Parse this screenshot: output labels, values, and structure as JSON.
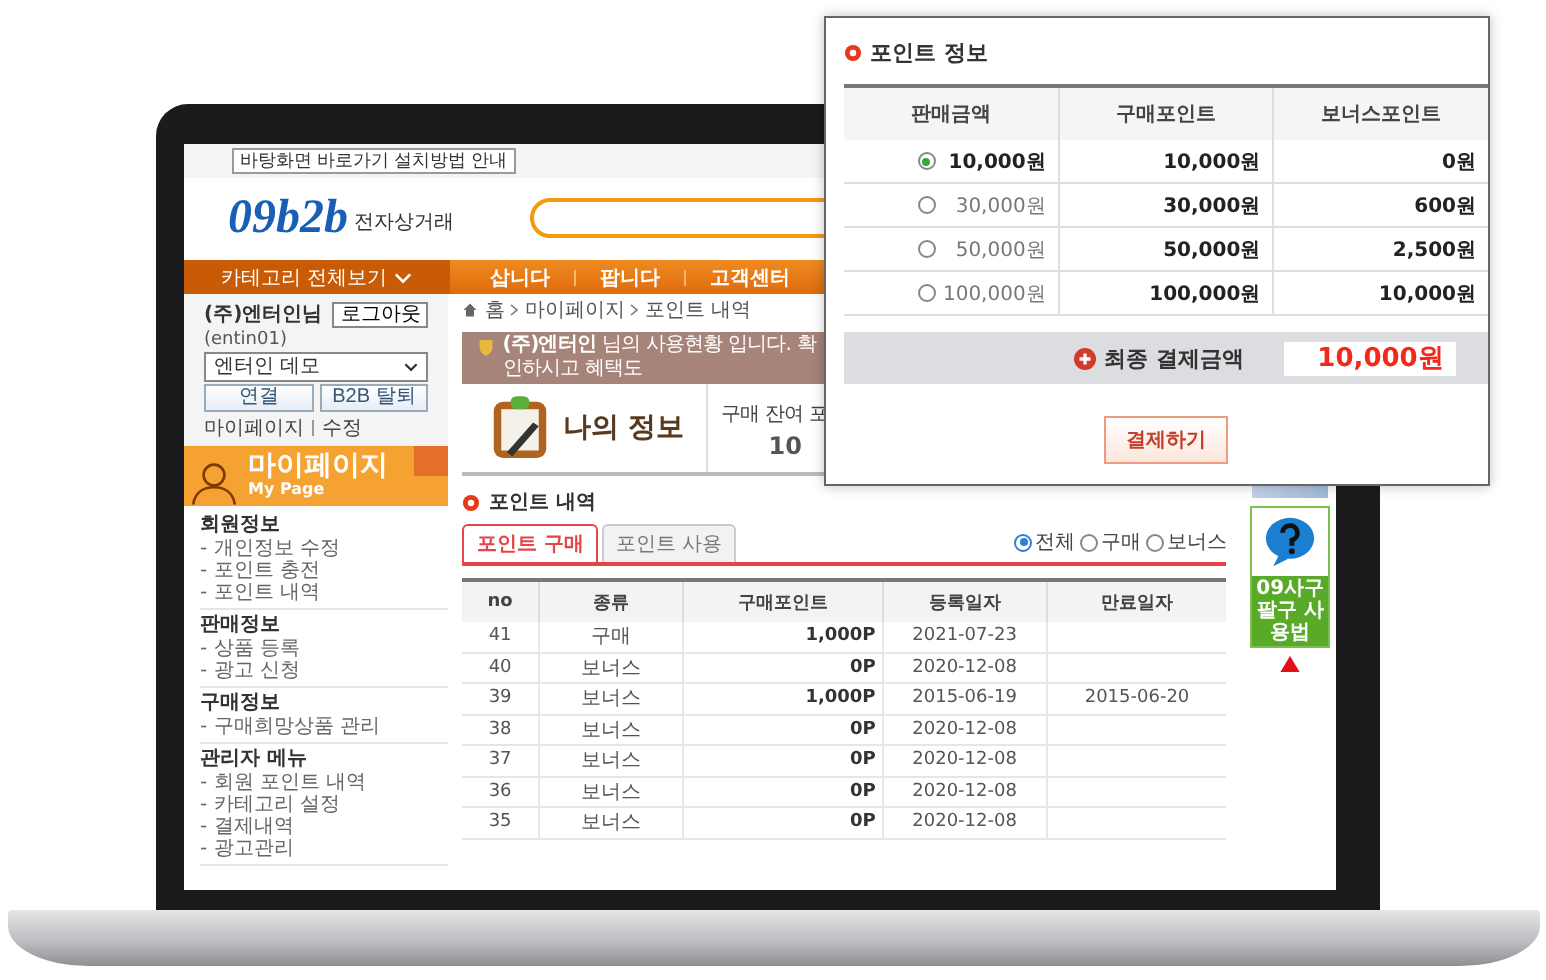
{
  "shortcut_button": "바탕화면 바로가기 설치방법 안내",
  "logo": {
    "text": "09b2b",
    "tagline": "전자상거래"
  },
  "nav": {
    "category_button": "카테고리 전체보기",
    "items": [
      "삽니다",
      "팝니다",
      "고객센터"
    ]
  },
  "account": {
    "name": "(주)엔터인님",
    "id": "(entin01)",
    "logout": "로그아웃",
    "select_value": "엔터인 데모",
    "buttons": [
      "연결",
      "B2B 탈퇴"
    ],
    "links": [
      "마이페이지",
      "수정"
    ]
  },
  "mypage_banner": {
    "title": "마이페이지",
    "subtitle": "My Page"
  },
  "menu": [
    {
      "heading": "회원정보",
      "items": [
        "- 개인정보 수정",
        "- 포인트 충전",
        "- 포인트 내역"
      ]
    },
    {
      "heading": "판매정보",
      "items": [
        "- 상품 등록",
        "- 광고 신청"
      ]
    },
    {
      "heading": "구매정보",
      "items": [
        "- 구매희망상품 관리"
      ]
    },
    {
      "heading": "관리자 메뉴",
      "items": [
        "- 회원 포인트 내역",
        "- 카테고리 설정",
        "- 결제내역",
        "- 광고관리"
      ]
    }
  ],
  "breadcrumb": [
    "홈",
    "마이페이지",
    "포인트 내역"
  ],
  "notice": "**(주)엔터인** 님의 사용현황 입니다. 확인하시고 혜택도",
  "my_info": {
    "title": "나의 정보",
    "label": "구매 잔여 포",
    "value": "10"
  },
  "points": {
    "title": "포인트 내역",
    "tabs": [
      {
        "label": "포인트 구매",
        "selected": true
      },
      {
        "label": "포인트 사용",
        "selected": false
      }
    ],
    "filters": [
      {
        "label": "전체",
        "selected": true
      },
      {
        "label": "구매",
        "selected": false
      },
      {
        "label": "보너스",
        "selected": false
      }
    ],
    "columns": [
      "no",
      "종류",
      "구매포인트",
      "등록일자",
      "만료일자"
    ],
    "rows": [
      [
        "41",
        "구매",
        "1,000P",
        "2021-07-23",
        ""
      ],
      [
        "40",
        "보너스",
        "0P",
        "2020-12-08",
        ""
      ],
      [
        "39",
        "보너스",
        "1,000P",
        "2015-06-19",
        "2015-06-20"
      ],
      [
        "38",
        "보너스",
        "0P",
        "2020-12-08",
        ""
      ],
      [
        "37",
        "보너스",
        "0P",
        "2020-12-08",
        ""
      ],
      [
        "36",
        "보너스",
        "0P",
        "2020-12-08",
        ""
      ],
      [
        "35",
        "보너스",
        "0P",
        "2020-12-08",
        ""
      ]
    ]
  },
  "side": {
    "help": "09사구팔구 사용법"
  },
  "popup": {
    "title": "포인트 정보",
    "columns": [
      "판매금액",
      "구매포인트",
      "보너스포인트"
    ],
    "options": [
      {
        "amount": "10,000원",
        "points": "10,000원",
        "bonus": "0원",
        "selected": true
      },
      {
        "amount": "30,000원",
        "points": "30,000원",
        "bonus": "600원",
        "selected": false
      },
      {
        "amount": "50,000원",
        "points": "50,000원",
        "bonus": "2,500원",
        "selected": false
      },
      {
        "amount": "100,000원",
        "points": "100,000원",
        "bonus": "10,000원",
        "selected": false
      }
    ],
    "total_label": "최종 결제금액",
    "total": "10,000원",
    "pay_button": "결제하기"
  }
}
